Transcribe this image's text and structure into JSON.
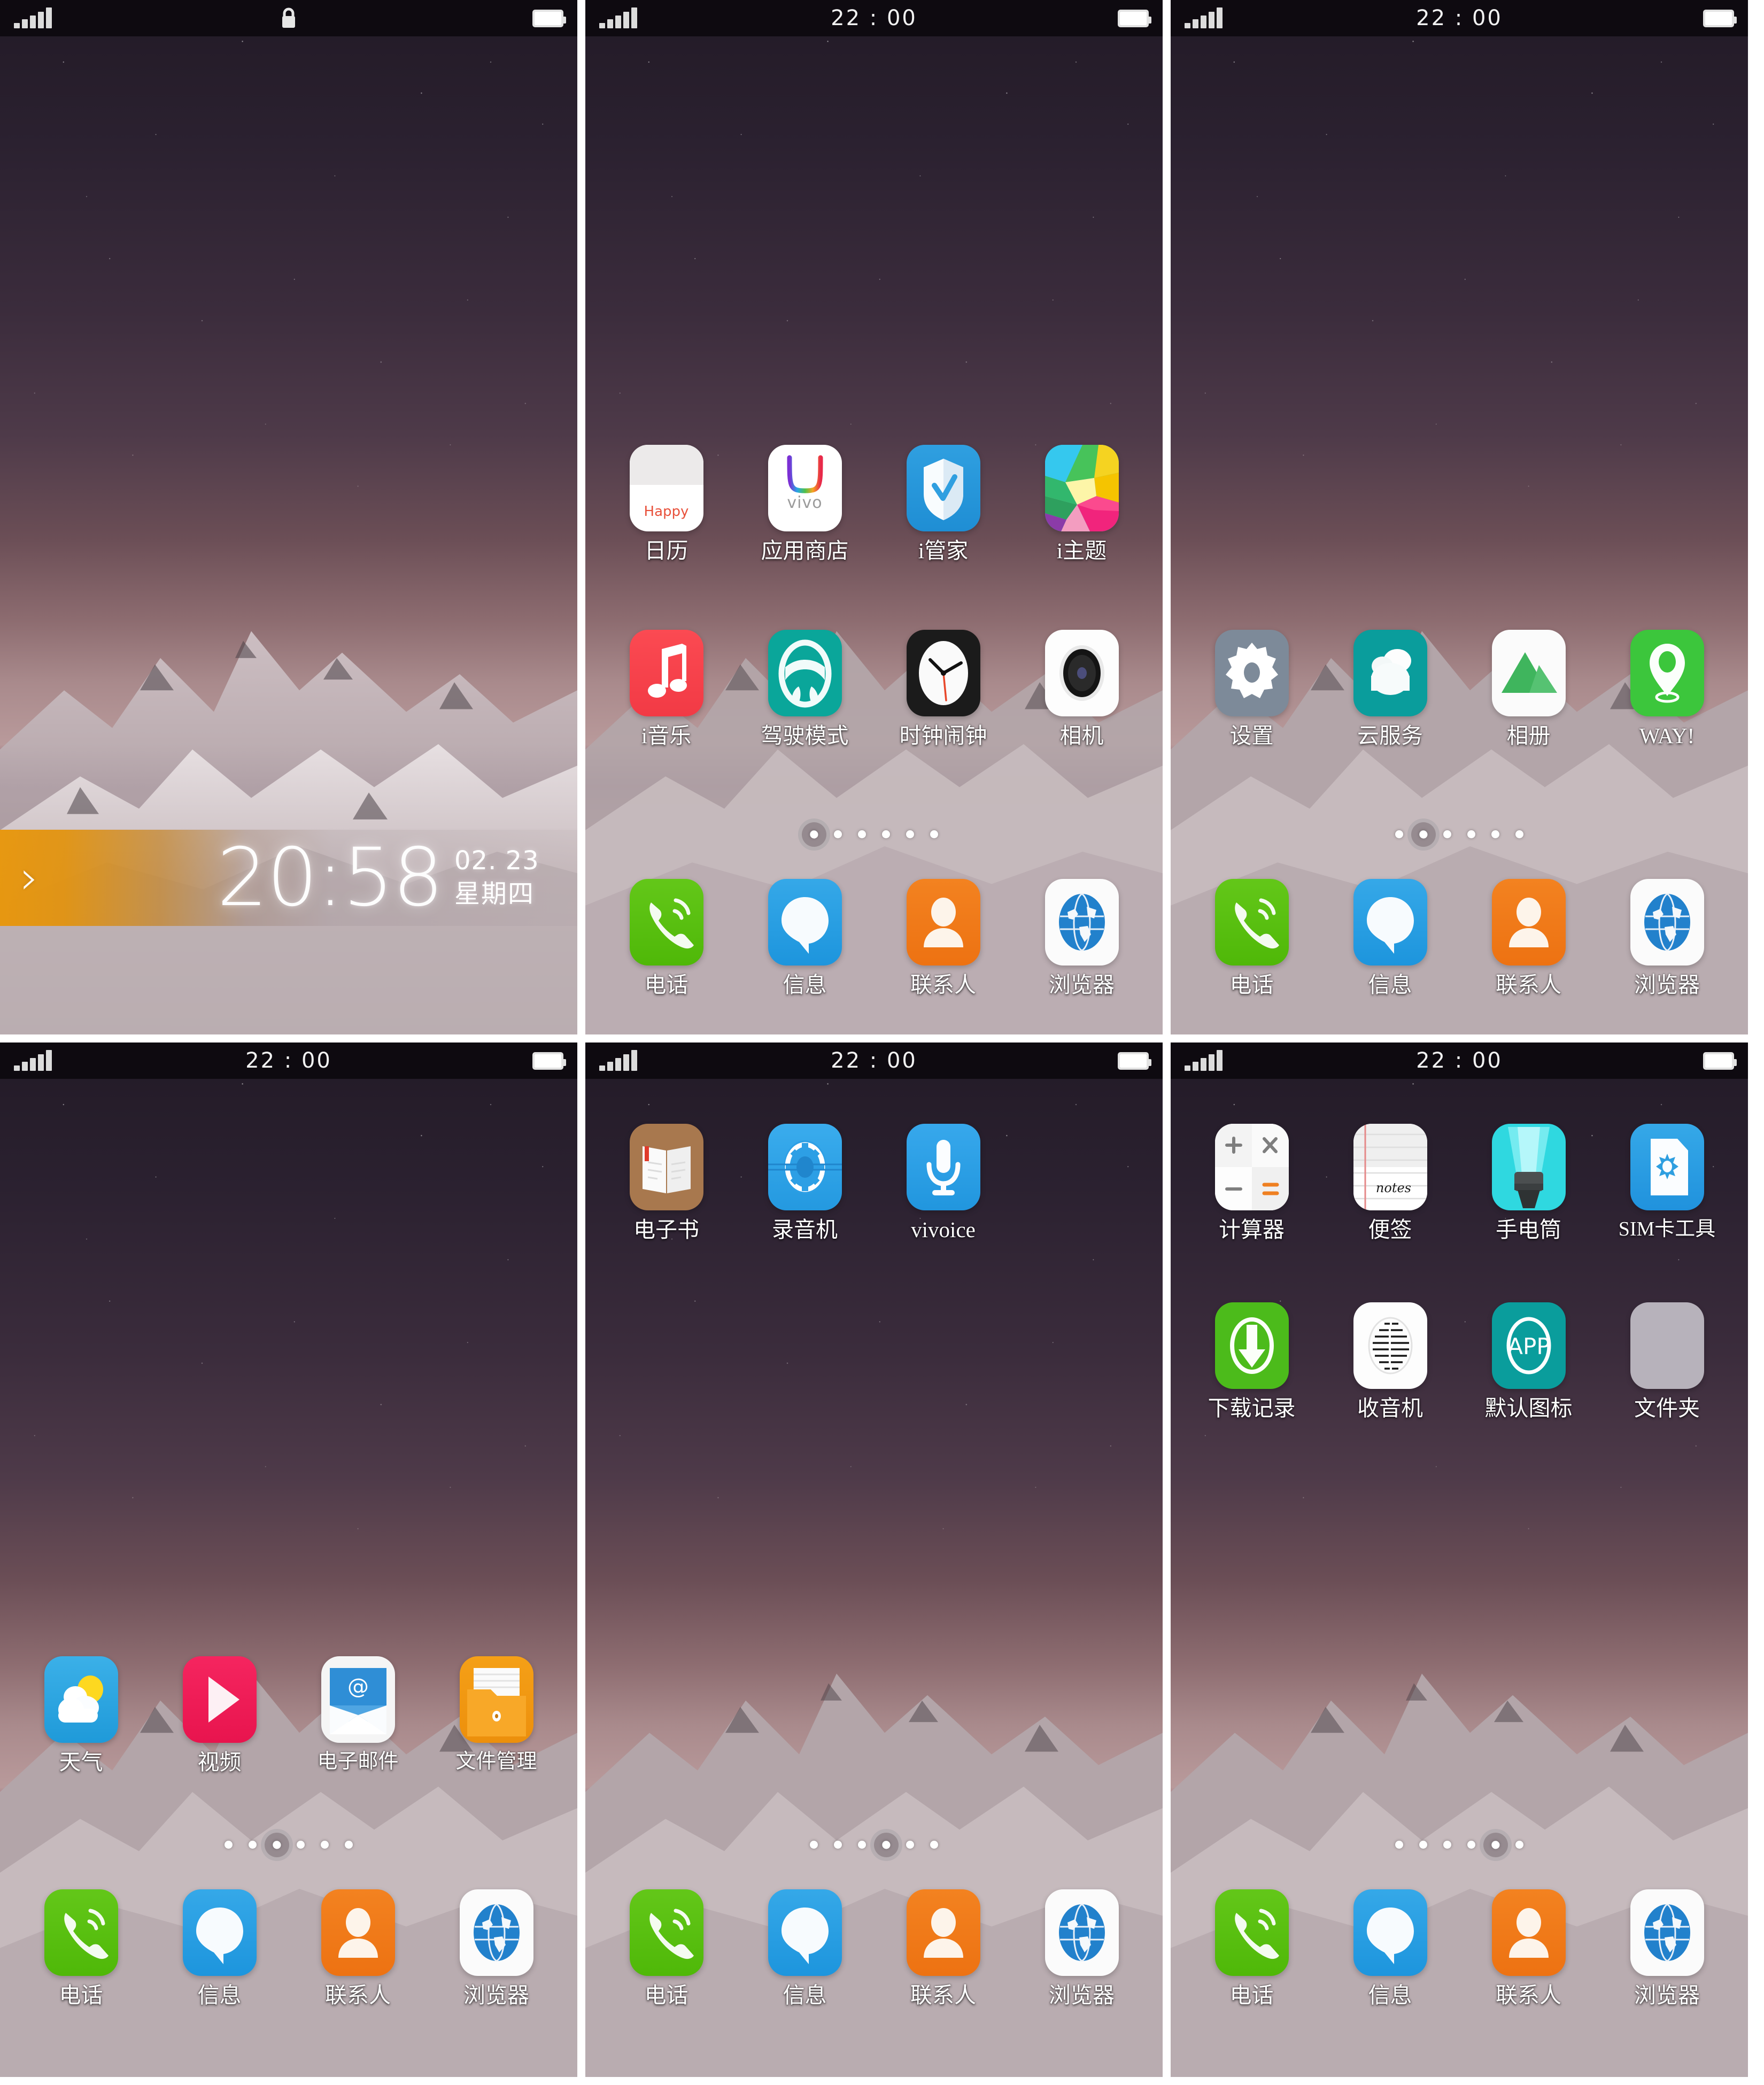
{
  "status_bar": {
    "time": "22 : 00",
    "signal_icon": "signal-bars-icon",
    "battery_icon": "battery-icon",
    "lock_icon": "lock-icon"
  },
  "lock_screen": {
    "time": "20:58",
    "date": "02. 23",
    "weekday": "星期四",
    "arrow": "›",
    "arrow_icon": "chevron-right-icon"
  },
  "panels": [
    {
      "name": "lockscreen",
      "type": "lock",
      "status_center": "",
      "dots": null
    },
    {
      "name": "home-page-1",
      "type": "home",
      "dots": {
        "count": 6,
        "active": 0
      },
      "rows": [
        [
          {
            "label": "日历",
            "icon": "calendar-icon"
          },
          {
            "label": "应用商店",
            "icon": "appstore-icon"
          },
          {
            "label": "i管家",
            "icon": "imanager-shield-icon"
          },
          {
            "label": "i主题",
            "icon": "itheme-icon"
          }
        ],
        [
          {
            "label": "i音乐",
            "icon": "music-note-icon"
          },
          {
            "label": "驾驶模式",
            "icon": "steering-wheel-icon"
          },
          {
            "label": "时钟闹钟",
            "icon": "clock-icon"
          },
          {
            "label": "相机",
            "icon": "camera-icon"
          }
        ]
      ]
    },
    {
      "name": "home-page-2",
      "type": "home",
      "dots": {
        "count": 6,
        "active": 1
      },
      "rows": [
        [
          {
            "label": "设置",
            "icon": "gear-icon"
          },
          {
            "label": "云服务",
            "icon": "cloud-icon"
          },
          {
            "label": "相册",
            "icon": "gallery-mountain-icon"
          },
          {
            "label": "WAY!",
            "icon": "map-pin-icon"
          }
        ]
      ]
    },
    {
      "name": "home-page-3",
      "type": "home",
      "dots": {
        "count": 6,
        "active": 2
      },
      "rows": [
        [
          {
            "label": "天气",
            "icon": "weather-sun-cloud-icon"
          },
          {
            "label": "视频",
            "icon": "play-triangle-icon"
          },
          {
            "label": "电子邮件",
            "icon": "email-envelope-icon"
          },
          {
            "label": "文件管理",
            "icon": "file-folder-icon"
          }
        ]
      ]
    },
    {
      "name": "home-page-4",
      "type": "home",
      "dots": {
        "count": 6,
        "active": 3
      },
      "rows": [
        [
          {
            "label": "电子书",
            "icon": "ebook-icon"
          },
          {
            "label": "录音机",
            "icon": "recorder-reel-icon"
          },
          {
            "label": "vivoice",
            "icon": "microphone-icon"
          }
        ]
      ]
    },
    {
      "name": "home-page-5",
      "type": "home",
      "dots": {
        "count": 6,
        "active": 4
      },
      "rows": [
        [
          {
            "label": "计算器",
            "icon": "calculator-icon"
          },
          {
            "label": "便签",
            "icon": "notes-icon"
          },
          {
            "label": "手电筒",
            "icon": "flashlight-icon"
          },
          {
            "label": "SIM卡工具",
            "icon": "sim-card-icon"
          }
        ],
        [
          {
            "label": "下载记录",
            "icon": "download-arrow-icon"
          },
          {
            "label": "收音机",
            "icon": "radio-icon"
          },
          {
            "label": "默认图标",
            "icon": "default-app-icon"
          },
          {
            "label": "文件夹",
            "icon": "folder-placeholder-icon"
          }
        ]
      ]
    }
  ],
  "dock": [
    {
      "label": "电话",
      "icon": "phone-handset-icon"
    },
    {
      "label": "信息",
      "icon": "message-bubble-icon"
    },
    {
      "label": "联系人",
      "icon": "contact-person-icon"
    },
    {
      "label": "浏览器",
      "icon": "globe-browser-icon"
    }
  ],
  "icon_text": {
    "calendar_happy": "Happy",
    "appstore_brand": "vivo",
    "notes_word": "notes",
    "app_word": "APP"
  },
  "colors": {
    "phone_green": "#55bf0d",
    "message_blue": "#2499e0",
    "contacts_orange": "#ef7a16",
    "shield_blue": "#2496da",
    "music_red": "#f7424c",
    "drive_teal": "#0aa69a",
    "way_green": "#3cc63c",
    "video_pink": "#ee1a55",
    "files_orange": "#f0950f",
    "torch_cyan": "#2fd8e0",
    "download_green": "#4cbb1b",
    "app_teal": "#0a9d9c",
    "lockwidget_orange": "#e8960a"
  }
}
